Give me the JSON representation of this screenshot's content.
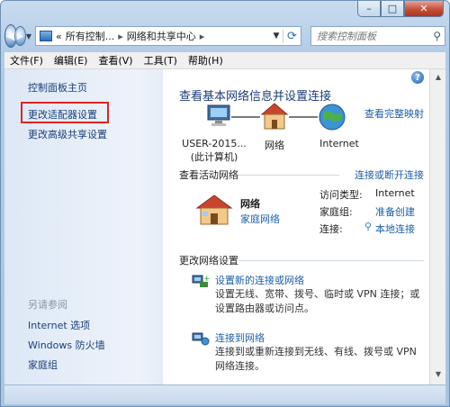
{
  "window": {
    "caption_min": "–",
    "caption_max": "□",
    "caption_close": "✕"
  },
  "nav": {
    "back_glyph": "◀",
    "forward_glyph": "▶",
    "history_glyph": "▼",
    "address": {
      "prefix": "«",
      "segment1": "所有控制...",
      "sep1": "▸",
      "segment2": "网络和共享中心",
      "sep2": "▸"
    },
    "search_placeholder": "搜索控制面板"
  },
  "menu": [
    "文件(F)",
    "编辑(E)",
    "查看(V)",
    "工具(T)",
    "帮助(H)"
  ],
  "left_pane": {
    "home": "控制面板主页",
    "change_adapter": "更改适配器设置",
    "change_sharing": "更改高级共享设置",
    "see_also": "另请参阅",
    "links": [
      "Internet 选项",
      "Windows 防火墙",
      "家庭组"
    ]
  },
  "main": {
    "help_glyph": "?",
    "title": "查看基本网络信息并设置连接",
    "view_full_map": "查看完整映射",
    "map": {
      "computer_line1": "USER-2015...",
      "computer_line2": "(此计算机)",
      "network": "网络",
      "internet": "Internet"
    },
    "active_networks_header": "查看活动网络",
    "connect_disconnect": "连接或断开连接",
    "network_name": "网络",
    "network_type": "家庭网络",
    "access_type_label": "访问类型:",
    "access_type_value": "Internet",
    "homegroup_label": "家庭组:",
    "homegroup_value": "准备创建",
    "connection_label": "连接:",
    "connection_value": "本地连接",
    "change_settings_header": "更改网络设置",
    "task1_title": "设置新的连接或网络",
    "task1_desc": "设置无线、宽带、拨号、临时或 VPN 连接；或设置路由器或访问点。",
    "task2_title": "连接到网络",
    "task2_desc": "连接到或重新连接到无线、有线、拨号或 VPN 网络连接。"
  },
  "colors": {
    "link": "#1d5fa8",
    "highlight_box": "#e02424"
  }
}
